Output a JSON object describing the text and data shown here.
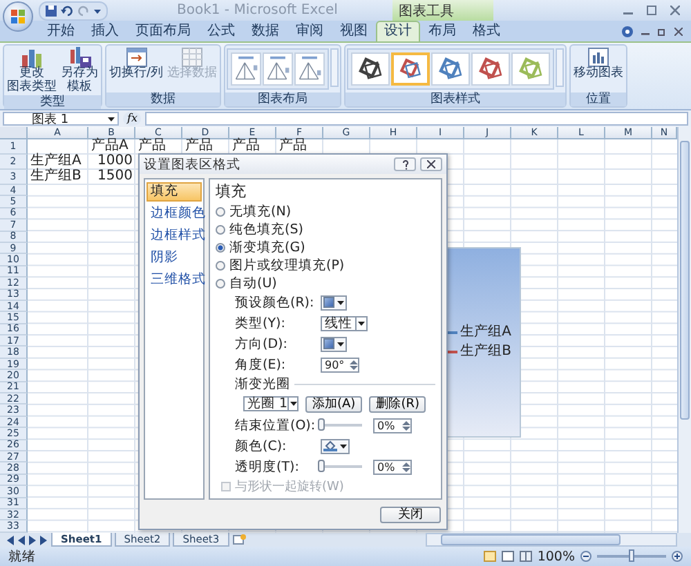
{
  "window": {
    "title": "Book1 - Microsoft Excel",
    "context_tab": "图表工具"
  },
  "tabs": [
    {
      "label": "开始",
      "selected": false
    },
    {
      "label": "插入",
      "selected": false
    },
    {
      "label": "页面布局",
      "selected": false
    },
    {
      "label": "公式",
      "selected": false
    },
    {
      "label": "数据",
      "selected": false
    },
    {
      "label": "审阅",
      "selected": false
    },
    {
      "label": "视图",
      "selected": false
    },
    {
      "label": "设计",
      "selected": true
    },
    {
      "label": "布局",
      "selected": false
    },
    {
      "label": "格式",
      "selected": false
    }
  ],
  "ribbon": [
    {
      "label": "类型",
      "kind": "buttons",
      "buttons": [
        {
          "kind": "chart_type",
          "lines": [
            "更改",
            "图表类型"
          ],
          "disabled": false
        },
        {
          "kind": "template",
          "lines": [
            "另存为",
            "模板"
          ],
          "disabled": false
        }
      ]
    },
    {
      "label": "数据",
      "kind": "buttons",
      "buttons": [
        {
          "kind": "switch",
          "lines": [
            "切换行/列"
          ],
          "disabled": false
        },
        {
          "kind": "select_data",
          "lines": [
            "选择数据"
          ],
          "disabled": true
        }
      ]
    },
    {
      "label": "图表布局",
      "kind": "layouts",
      "items": [
        {
          "selected": false
        },
        {
          "selected": false
        },
        {
          "selected": false
        }
      ]
    },
    {
      "label": "图表样式",
      "kind": "styles",
      "items": [
        {
          "color": "#404040",
          "selected": false
        },
        {
          "color": "#c0504d",
          "selected": true
        },
        {
          "color": "#4f81bd",
          "selected": false
        },
        {
          "color": "#c0504d",
          "selected": false
        },
        {
          "color": "#9bbb59",
          "selected": false
        }
      ]
    },
    {
      "label": "位置",
      "kind": "buttons",
      "buttons": [
        {
          "kind": "move",
          "lines": [
            "移动图表"
          ],
          "disabled": false
        }
      ]
    }
  ],
  "formula_bar": {
    "name_box": "图表 1",
    "function_button": "fx"
  },
  "columns": [
    "A",
    "B",
    "C",
    "D",
    "E",
    "F",
    "G",
    "H",
    "I",
    "J",
    "K",
    "L",
    "M",
    "N"
  ],
  "rows": [
    {
      "number": "1",
      "cells": [
        null,
        {
          "text": "产品A",
          "kind": "text"
        },
        {
          "text": "产品",
          "kind": "text"
        },
        {
          "text": "产品",
          "kind": "text"
        },
        {
          "text": "产品",
          "kind": "text"
        },
        {
          "text": "产品",
          "kind": "text"
        }
      ]
    },
    {
      "number": "2",
      "cells": [
        {
          "text": "生产组A",
          "kind": "text"
        },
        {
          "text": "1000",
          "kind": "number"
        }
      ]
    },
    {
      "number": "3",
      "cells": [
        {
          "text": "生产组B",
          "kind": "text"
        },
        {
          "text": "1500",
          "kind": "number"
        }
      ]
    },
    {
      "number": "4"
    },
    {
      "number": "5"
    },
    {
      "number": "6"
    },
    {
      "number": "7"
    },
    {
      "number": "8"
    },
    {
      "number": "9"
    },
    {
      "number": "10"
    },
    {
      "number": "11"
    },
    {
      "number": "12"
    },
    {
      "number": "13"
    },
    {
      "number": "14"
    },
    {
      "number": "15"
    },
    {
      "number": "16"
    },
    {
      "number": "17"
    },
    {
      "number": "18"
    },
    {
      "number": "19"
    },
    {
      "number": "20"
    },
    {
      "number": "21"
    },
    {
      "number": "22"
    },
    {
      "number": "23"
    },
    {
      "number": "24"
    },
    {
      "number": "25"
    },
    {
      "number": "26"
    },
    {
      "number": "27"
    },
    {
      "number": "28"
    },
    {
      "number": "29"
    },
    {
      "number": "30"
    },
    {
      "number": "31"
    },
    {
      "number": "32"
    },
    {
      "number": "33"
    }
  ],
  "chart": {
    "legend": [
      {
        "label": "生产组A",
        "color": "#4f81bd"
      },
      {
        "label": "生产组B",
        "color": "#c0504d"
      }
    ]
  },
  "dialog": {
    "title": "设置图表区格式",
    "nav": [
      {
        "label": "填充",
        "selected": true
      },
      {
        "label": "边框颜色",
        "selected": false
      },
      {
        "label": "边框样式",
        "selected": false
      },
      {
        "label": "阴影",
        "selected": false
      },
      {
        "label": "三维格式",
        "selected": false
      }
    ],
    "heading": "填充",
    "fill_options": [
      {
        "label": "无填充(N)",
        "selected": false
      },
      {
        "label": "纯色填充(S)",
        "selected": false
      },
      {
        "label": "渐变填充(G)",
        "selected": true
      },
      {
        "label": "图片或纹理填充(P)",
        "selected": false
      },
      {
        "label": "自动(U)",
        "selected": false
      }
    ],
    "fields": [
      {
        "kind": "swatch",
        "label": "预设颜色(R):"
      },
      {
        "kind": "select",
        "label": "类型(Y):",
        "value": "线性"
      },
      {
        "kind": "swatch",
        "label": "方向(D):"
      },
      {
        "kind": "spinner",
        "label": "角度(E):",
        "value": "90°"
      }
    ],
    "stops_heading": "渐变光圈",
    "stop_select": "光圈 1",
    "add_button": "添加(A)",
    "delete_button": "删除(R)",
    "stop_fields": [
      {
        "kind": "slider",
        "label": "结束位置(O):",
        "level": 0,
        "value": "0%"
      },
      {
        "kind": "color",
        "label": "颜色(C):"
      },
      {
        "kind": "slider",
        "label": "透明度(T):",
        "level": 0,
        "value": "0%"
      }
    ],
    "rotate_checkbox": {
      "label": "与形状一起旋转(W)",
      "checked": false,
      "disabled": true
    },
    "close_button": "关闭"
  },
  "sheet_tabs": [
    {
      "label": "Sheet1",
      "selected": true
    },
    {
      "label": "Sheet2",
      "selected": false
    },
    {
      "label": "Sheet3",
      "selected": false
    }
  ],
  "status_bar": {
    "status": "就绪",
    "zoom": "100%",
    "zoom_slider": {
      "level": 0.5
    }
  }
}
